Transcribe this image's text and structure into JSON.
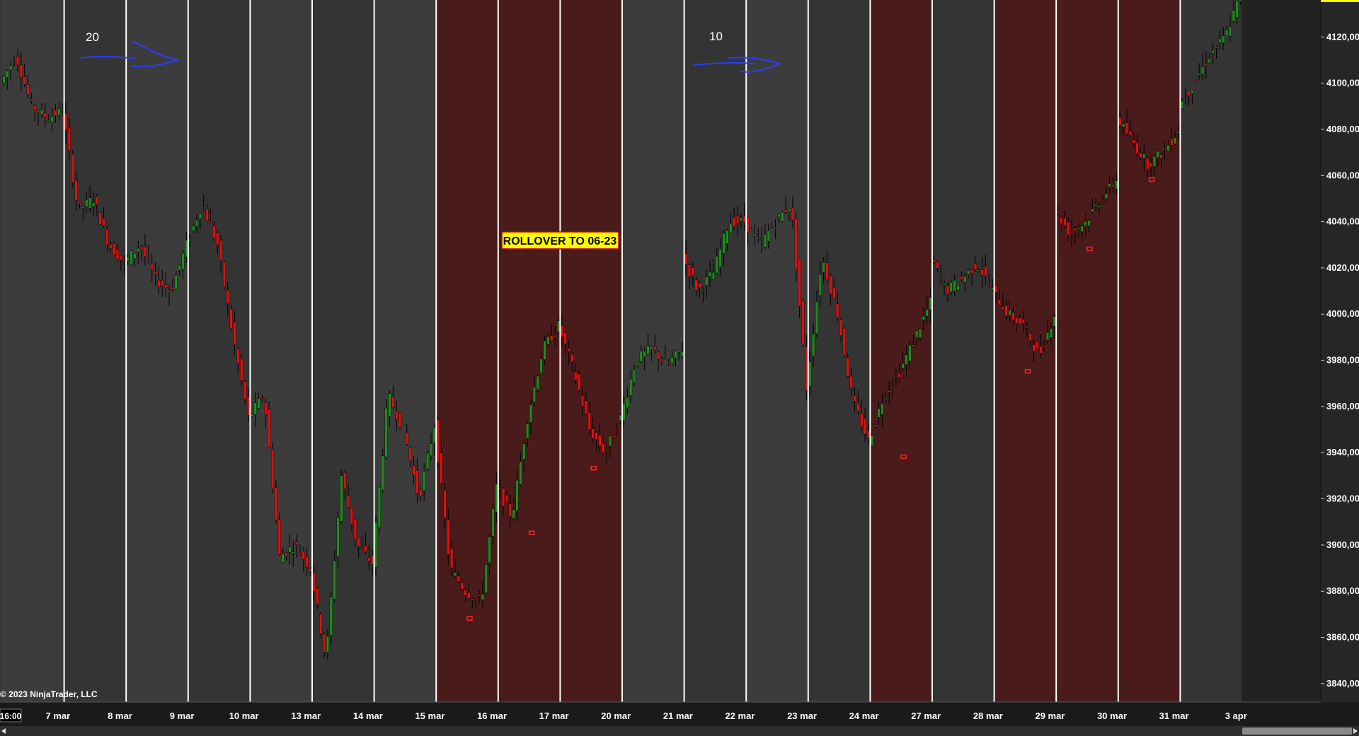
{
  "chart": {
    "copyright": "© 2023 NinjaTrader, LLC",
    "time_label": "16:00",
    "rollover_label": "ROLLOVER TO 06-23",
    "annotations": [
      {
        "text": "20"
      },
      {
        "text": "10"
      }
    ],
    "colors": {
      "background": "#383838",
      "day_panel_light": "#3c3c3c",
      "day_panel_dark": "#343434",
      "highlight_panel": "#4a1b1b",
      "future_panel": "#222222",
      "separator": "#ffffff",
      "up_candle": "#1e8c1e",
      "down_candle": "#e01010",
      "wick": "#000000",
      "annotation_ink": "#2a3cff",
      "rollover_bg": "#ffff00",
      "marker": "#ff2020"
    }
  },
  "chart_data": {
    "type": "candlestick",
    "title": "",
    "xlabel": "",
    "ylabel": "",
    "ylim": [
      3832,
      4136
    ],
    "y_ticks": [
      3840,
      3860,
      3880,
      3900,
      3920,
      3940,
      3960,
      3980,
      4000,
      4020,
      4040,
      4060,
      4080,
      4100,
      4120
    ],
    "y_tick_labels": [
      "3840,00",
      "3860,00",
      "3880,00",
      "3900,00",
      "3920,00",
      "3940,00",
      "3960,00",
      "3980,00",
      "4000,00",
      "4020,00",
      "4040,00",
      "4060,00",
      "4080,00",
      "4100,00",
      "4120,00"
    ],
    "grid": false,
    "sessions": [
      {
        "label": "7 mar",
        "highlight": false,
        "path": [
          4100,
          4112,
          4090,
          4085,
          4088
        ]
      },
      {
        "label": "8 mar",
        "highlight": false,
        "path": [
          4088,
          4045,
          4050,
          4030,
          4022
        ]
      },
      {
        "label": "9 mar",
        "highlight": false,
        "path": [
          4022,
          4030,
          4015,
          4010,
          4030
        ]
      },
      {
        "label": "10 mar",
        "highlight": false,
        "path": [
          4030,
          4048,
          4030,
          3990,
          3955
        ]
      },
      {
        "label": "13 mar",
        "highlight": false,
        "path": [
          3955,
          3965,
          3895,
          3900,
          3890
        ]
      },
      {
        "label": "14 mar",
        "highlight": false,
        "path": [
          3890,
          3850,
          3930,
          3900,
          3892
        ]
      },
      {
        "label": "15 mar",
        "highlight": false,
        "path": [
          3892,
          3965,
          3950,
          3920,
          3952
        ]
      },
      {
        "label": "16 mar",
        "highlight": true,
        "path": [
          3952,
          3890,
          3880,
          3875,
          3925
        ]
      },
      {
        "label": "17 mar",
        "highlight": true,
        "path": [
          3925,
          3912,
          3955,
          3985,
          3995
        ]
      },
      {
        "label": "20 mar",
        "highlight": true,
        "path": [
          3995,
          3975,
          3950,
          3940,
          3955
        ]
      },
      {
        "label": "21 mar",
        "highlight": false,
        "path": [
          3955,
          3980,
          3985,
          3978,
          3985
        ]
      },
      {
        "label": "22 mar",
        "highlight": false,
        "path": [
          4025,
          4010,
          4018,
          4040,
          4040
        ]
      },
      {
        "label": "23 mar",
        "highlight": false,
        "path": [
          4040,
          4030,
          4040,
          4048,
          3968
        ]
      },
      {
        "label": "24 mar",
        "highlight": false,
        "path": [
          3968,
          4025,
          4000,
          3962,
          3945
        ]
      },
      {
        "label": "27 mar",
        "highlight": true,
        "path": [
          3945,
          3965,
          3975,
          3990,
          4005
        ]
      },
      {
        "label": "28 mar",
        "highlight": false,
        "path": [
          4025,
          4010,
          4015,
          4022,
          4010
        ]
      },
      {
        "label": "29 mar",
        "highlight": true,
        "path": [
          4010,
          4000,
          3995,
          3982,
          4000
        ]
      },
      {
        "label": "30 mar",
        "highlight": true,
        "path": [
          4045,
          4035,
          4040,
          4050,
          4058
        ]
      },
      {
        "label": "31 mar",
        "highlight": true,
        "path": [
          4085,
          4075,
          4065,
          4070,
          4080
        ]
      },
      {
        "label": "3 apr",
        "highlight": false,
        "path": [
          4090,
          4100,
          4112,
          4120,
          4138
        ]
      }
    ]
  }
}
